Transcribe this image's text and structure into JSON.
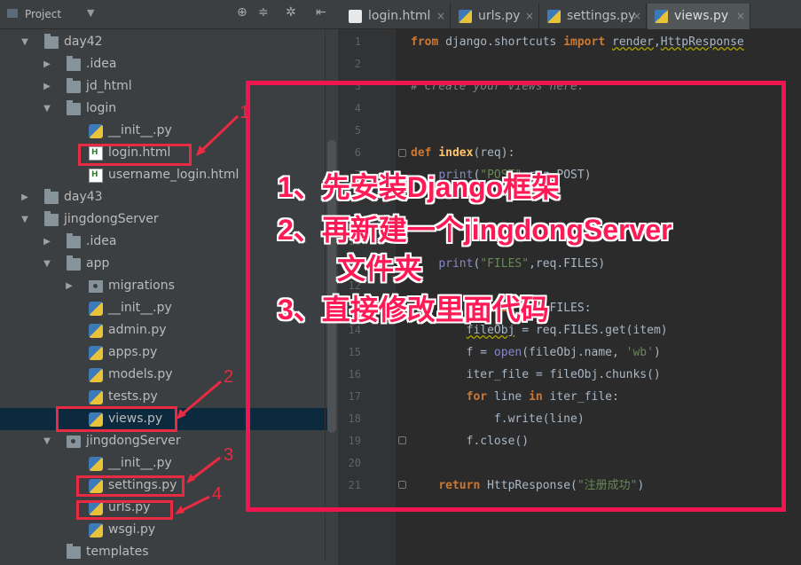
{
  "sidebar": {
    "title": "Project",
    "tree": [
      {
        "label": "day42",
        "depth": 0,
        "type": "folder",
        "arrow": "▼"
      },
      {
        "label": ".idea",
        "depth": 1,
        "type": "folder",
        "arrow": "▶"
      },
      {
        "label": "jd_html",
        "depth": 1,
        "type": "folder",
        "arrow": "▶"
      },
      {
        "label": "login",
        "depth": 1,
        "type": "folder",
        "arrow": "▼"
      },
      {
        "label": "__init__.py",
        "depth": 2,
        "type": "py"
      },
      {
        "label": "login.html",
        "depth": 2,
        "type": "html"
      },
      {
        "label": "username_login.html",
        "depth": 2,
        "type": "html"
      },
      {
        "label": "day43",
        "depth": 0,
        "type": "folder",
        "arrow": "▶"
      },
      {
        "label": "jingdongServer",
        "depth": 0,
        "type": "folder",
        "arrow": "▼"
      },
      {
        "label": ".idea",
        "depth": 1,
        "type": "folder",
        "arrow": "▶"
      },
      {
        "label": "app",
        "depth": 1,
        "type": "folder",
        "arrow": "▼"
      },
      {
        "label": "migrations",
        "depth": 2,
        "type": "pkg",
        "arrow": "▶"
      },
      {
        "label": "__init__.py",
        "depth": 2,
        "type": "py"
      },
      {
        "label": "admin.py",
        "depth": 2,
        "type": "py"
      },
      {
        "label": "apps.py",
        "depth": 2,
        "type": "py"
      },
      {
        "label": "models.py",
        "depth": 2,
        "type": "py"
      },
      {
        "label": "tests.py",
        "depth": 2,
        "type": "py"
      },
      {
        "label": "views.py",
        "depth": 2,
        "type": "py",
        "selected": true
      },
      {
        "label": "jingdongServer",
        "depth": 1,
        "type": "pkg",
        "arrow": "▼"
      },
      {
        "label": "__init__.py",
        "depth": 2,
        "type": "py"
      },
      {
        "label": "settings.py",
        "depth": 2,
        "type": "py"
      },
      {
        "label": "urls.py",
        "depth": 2,
        "type": "py"
      },
      {
        "label": "wsgi.py",
        "depth": 2,
        "type": "py"
      },
      {
        "label": "templates",
        "depth": 1,
        "type": "folder"
      }
    ]
  },
  "tabs": [
    {
      "label": "login.html",
      "type": "html",
      "active": false
    },
    {
      "label": "urls.py",
      "type": "py",
      "active": false
    },
    {
      "label": "settings.py",
      "type": "py",
      "active": false
    },
    {
      "label": "views.py",
      "type": "py",
      "active": true
    }
  ],
  "code_lines": [
    {
      "n": "1",
      "html": "<span class=\"kw\">from</span> django.shortcuts <span class=\"kw\">import</span> <span class=\"squig\">render</span>,<span class=\"squig\">HttpResponse</span>"
    },
    {
      "n": "2",
      "html": ""
    },
    {
      "n": "3",
      "html": "<span class=\"cmt\"># Create your views here.</span>"
    },
    {
      "n": "4",
      "html": ""
    },
    {
      "n": "5",
      "html": ""
    },
    {
      "n": "6",
      "html": "<span class=\"kw\">def</span> <span class=\"fn\">index</span>(req):"
    },
    {
      "n": "7",
      "html": "    <span class=\"bi\">print</span>(<span class=\"str\">\"POST\"</span>,req.POST)"
    },
    {
      "n": "8",
      "html": ""
    },
    {
      "n": "9",
      "html": ""
    },
    {
      "n": "10",
      "html": ""
    },
    {
      "n": "11",
      "html": "    <span class=\"bi\">print</span>(<span class=\"str\">\"FILES\"</span>,req.FILES)"
    },
    {
      "n": "12",
      "html": ""
    },
    {
      "n": "13",
      "html": "    <span class=\"kw\">for</span> item <span class=\"kw\">in</span> req.FILES:"
    },
    {
      "n": "14",
      "html": "        <span class=\"squig\">fileObj</span> = req.FILES.get(item)"
    },
    {
      "n": "15",
      "html": "        f = <span class=\"bi\">open</span>(fileObj.name, <span class=\"str\">'wb'</span>)"
    },
    {
      "n": "16",
      "html": "        iter_file = fileObj.chunks()"
    },
    {
      "n": "17",
      "html": "        <span class=\"kw\">for</span> line <span class=\"kw\">in</span> iter_file:"
    },
    {
      "n": "18",
      "html": "            f.write(line)"
    },
    {
      "n": "19",
      "html": "        f.close()"
    },
    {
      "n": "20",
      "html": ""
    },
    {
      "n": "21",
      "html": "    <span class=\"kw\">return</span> HttpResponse(<span class=\"str\">\"注册成功\"</span>)"
    }
  ],
  "annotations": {
    "numbers": [
      "1",
      "2",
      "3",
      "4"
    ],
    "steps": [
      "1、先安装Django框架",
      "2、再新建一个jingdongServer",
      "文件夹",
      "3、直接修改里面代码"
    ]
  }
}
